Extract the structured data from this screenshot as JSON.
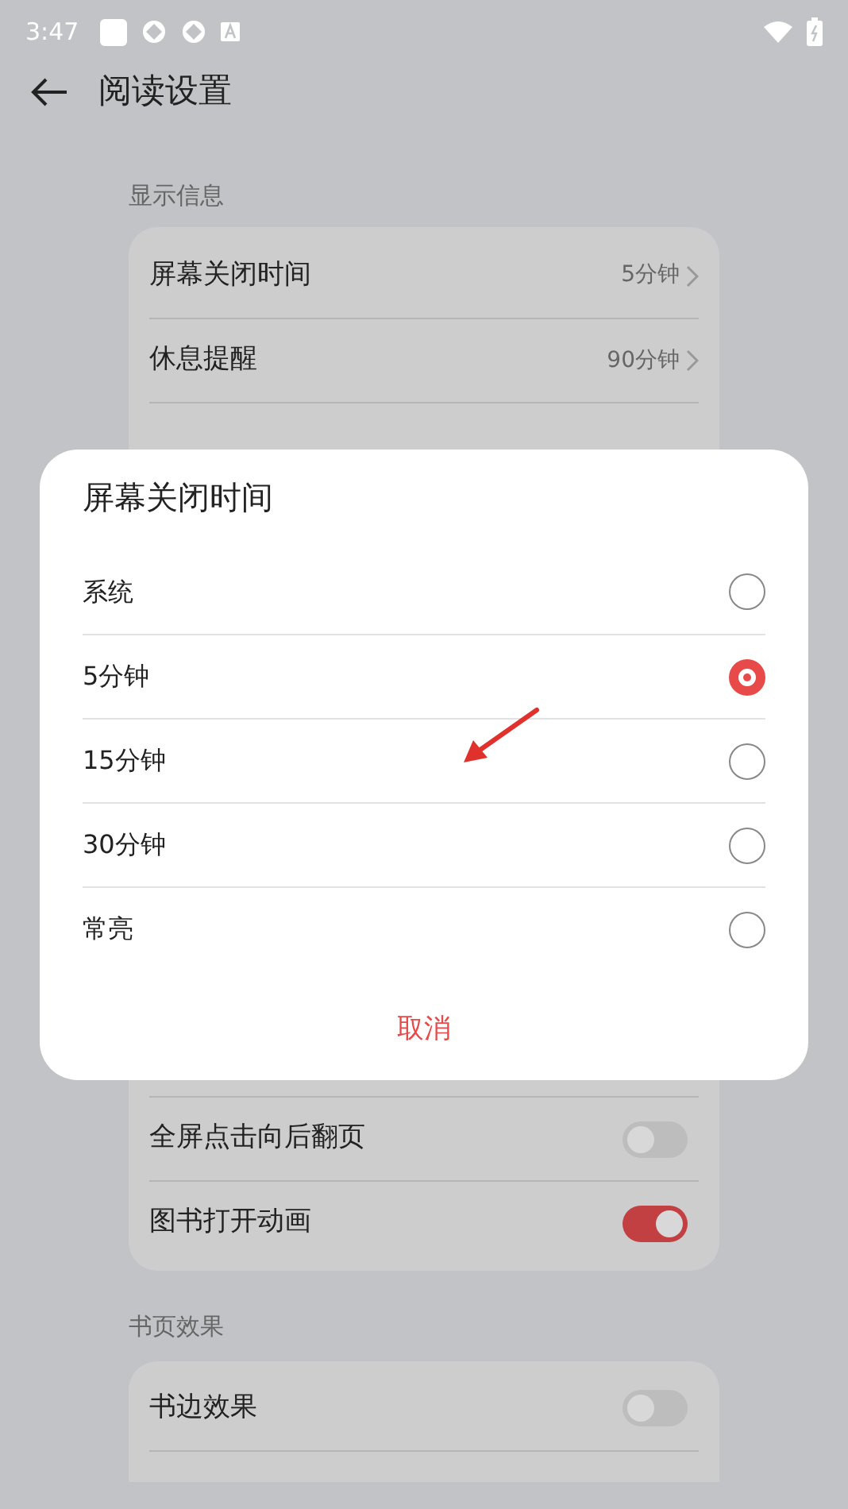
{
  "status_bar": {
    "time": "3:47"
  },
  "header": {
    "title": "阅读设置"
  },
  "sections": [
    {
      "title": "显示信息",
      "rows": [
        {
          "kind": "value",
          "label": "屏幕关闭时间",
          "value": "5分钟"
        },
        {
          "kind": "value",
          "label": "休息提醒",
          "value": "90分钟"
        }
      ],
      "rows_below": [
        {
          "kind": "switch",
          "label": "全屏点击向后翻页",
          "on": false
        },
        {
          "kind": "switch",
          "label": "图书打开动画",
          "on": true
        }
      ]
    },
    {
      "title": "书页效果",
      "rows": [
        {
          "kind": "switch",
          "label": "书边效果",
          "on": false
        }
      ]
    }
  ],
  "dialog": {
    "title": "屏幕关闭时间",
    "options": [
      {
        "label": "系统",
        "selected": false
      },
      {
        "label": "5分钟",
        "selected": true
      },
      {
        "label": "15分钟",
        "selected": false
      },
      {
        "label": "30分钟",
        "selected": false
      },
      {
        "label": "常亮",
        "selected": false
      }
    ],
    "cancel": "取消"
  }
}
